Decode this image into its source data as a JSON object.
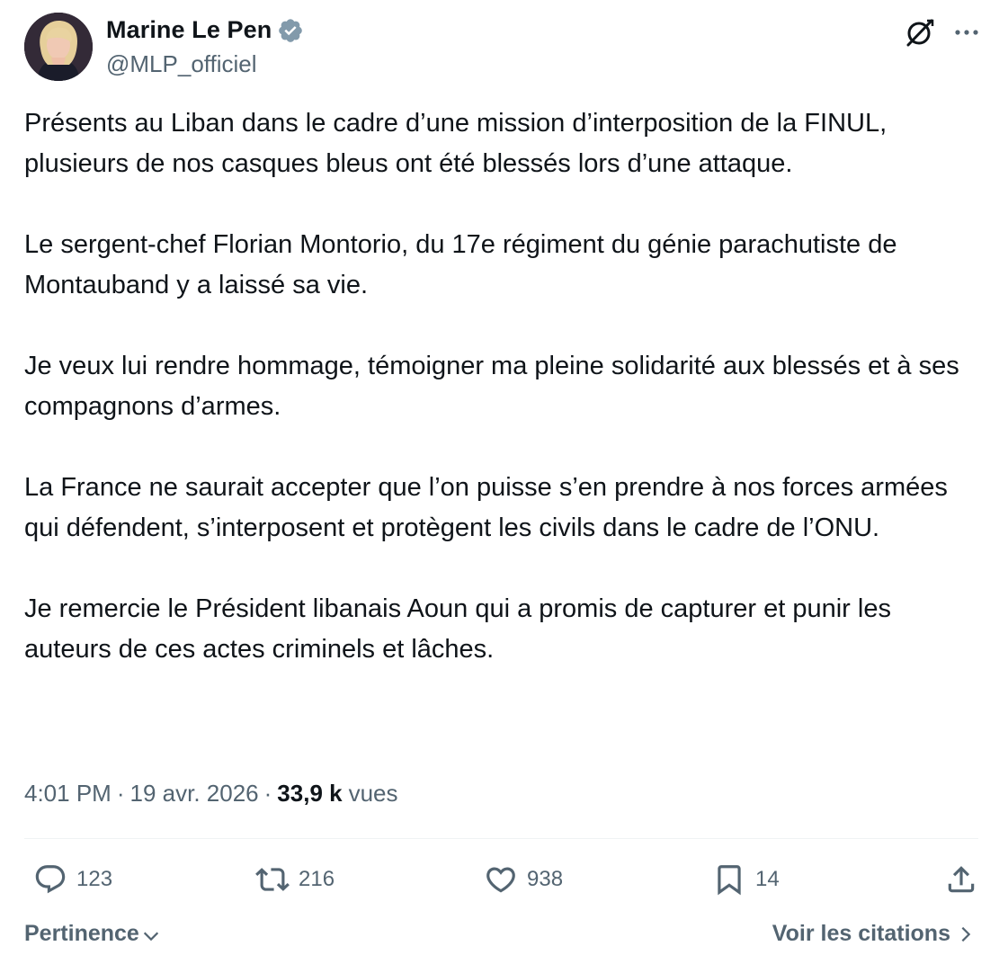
{
  "author": {
    "name": "Marine Le Pen",
    "handle": "@MLP_officiel",
    "verified_color": "#829aab"
  },
  "post": {
    "paragraphs": [
      "Présents au Liban dans le cadre d’une mission d’interposition de la FINUL,  plusieurs de nos casques bleus ont été blessés lors d’une attaque.",
      "Le sergent-chef Florian Montorio, du 17e régiment du génie parachutiste de Montauband y a laissé sa vie.",
      "Je veux lui rendre hommage, témoigner ma pleine solidarité aux blessés et à ses compagnons d’armes.",
      "La France ne saurait accepter que l’on puisse s’en prendre à nos forces armées qui défendent, s’interposent et protègent les civils dans le cadre de l’ONU.",
      "Je remercie le Président libanais Aoun qui a promis de capturer et punir les auteurs de ces actes criminels et lâches."
    ]
  },
  "meta": {
    "time": "4:01 PM",
    "separator": "·",
    "date": "19 avr. 2026",
    "views_count": "33,9 k",
    "views_label": "vues"
  },
  "actions": {
    "replies": "123",
    "reposts": "216",
    "likes": "938",
    "bookmarks": "14"
  },
  "footer": {
    "sort_label": "Pertinence",
    "quotes_label": "Voir les citations"
  },
  "icons": {
    "avatar": "profile-photo",
    "verified": "verified-badge-icon",
    "grok": "grok-icon",
    "more": "more-icon",
    "reply": "reply-icon",
    "repost": "repost-icon",
    "like": "heart-icon",
    "bookmark": "bookmark-icon",
    "share": "share-icon"
  },
  "colors": {
    "text": "#0f1419",
    "secondary": "#536471",
    "divider": "#eff3f4"
  }
}
